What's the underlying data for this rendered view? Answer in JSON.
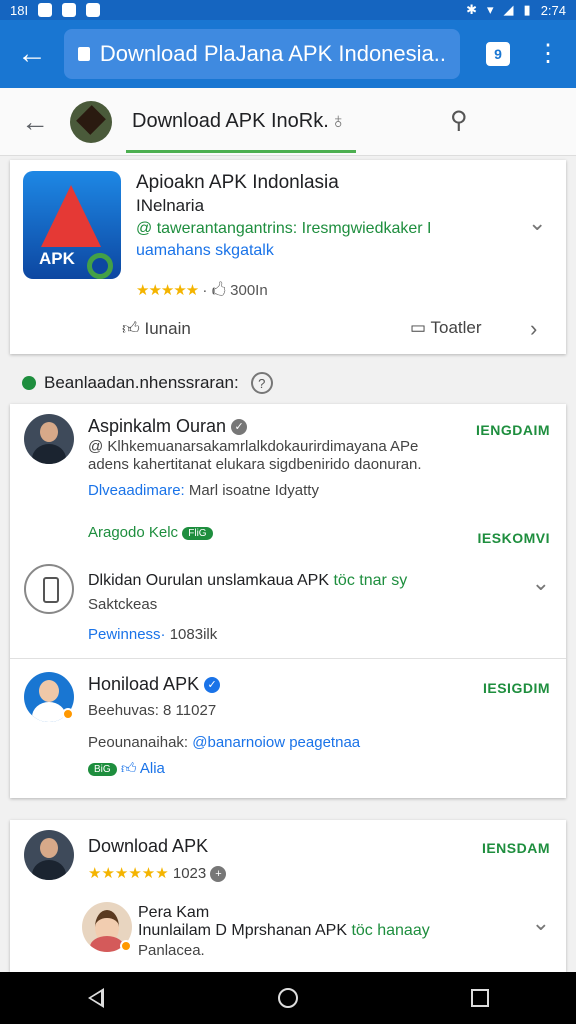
{
  "status": {
    "left": "18I",
    "time": "2:74"
  },
  "browser": {
    "url_text": "Download  PlaJana APK Indonesia..",
    "tabs_count": "9"
  },
  "search": {
    "query": "Download APK InoRk."
  },
  "app": {
    "title": "Apioakn APK Indonlasia",
    "subtitle": "INelnaria",
    "desc_green": "@ tawerantangantrins: Iresmgwiedkaker I",
    "desc_blue": "uamahans skgatalk",
    "rating_stars": "★★★★★",
    "rating_count": "· 🖒 300In",
    "icon_text": "APK",
    "action_left": "Iunain",
    "action_right": "Toatler"
  },
  "section": {
    "title": "Beanlaadan.nhenssraran:",
    "info": "?"
  },
  "reviews": [
    {
      "name": "Aspinkalm Ouran",
      "line1": "@ Klhkemuanarsakamrlalkdokaurirdimayana APe",
      "line2": "adens kahertitanat elukara sigdbenirido daonuran.",
      "line3_b": "Dlveaadimare:",
      "line3": " Marl isoatne Idyatty",
      "footer": "Aragodo Kelc",
      "pill": "FliG",
      "tag_top": "IENGDAIM",
      "tag_bottom": "IESKOMVI"
    },
    {
      "name": "Dlkidan  Ourulan unslamkaua APK",
      "name_green": " töc tnar sy",
      "line1": "Saktckeas",
      "line2_b": "Pewinness·",
      "line2": " 1083ilk"
    },
    {
      "name": "Honiload APK",
      "line1": "Beehuvas: 8 11027",
      "line2": "Peounanaihak: ",
      "line2_b": "@banarnoiow peagetnaa",
      "pill": "BiG",
      "like": "Alia",
      "tag": "IESIGDIM"
    }
  ],
  "card2": {
    "name": "Download APK",
    "stars": "★★★★★★",
    "count": "1023",
    "tag": "IENSDAM",
    "sub_name": "Pera Kam",
    "sub_line": "Inunlailam D Mprshanan APK",
    "sub_green": " töc hanaay",
    "sub_line2": "Panlacea."
  }
}
